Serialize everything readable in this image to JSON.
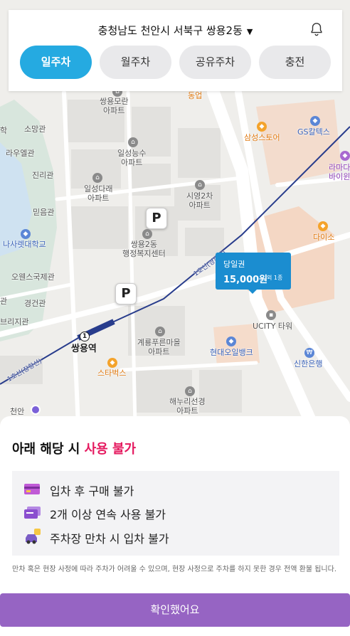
{
  "header": {
    "location": "충청남도 천안시 서북구 쌍용2동",
    "tabs": [
      {
        "label": "일주차",
        "active": true
      },
      {
        "label": "월주차",
        "active": false
      },
      {
        "label": "공유주차",
        "active": false
      },
      {
        "label": "충전",
        "active": false
      }
    ]
  },
  "map": {
    "rail_label": "1호선(경부선)",
    "rail_label_2": "1호선(장항선)",
    "station_badge": "1",
    "station_name": "쌍용역",
    "parking_marker": "P",
    "places": {
      "ssangyong_moran": "쌍용모란\n아파트",
      "ilseong_neungsu": "일성능수\n아파트",
      "ilseong_darae": "일성다래\n아파트",
      "siyeong2": "시영2차\n아파트",
      "admin_center": "쌍용2동\n행정복지센터",
      "samsung_store": "삼성스토어",
      "gs_caltex": "GS칼텍스",
      "lamada": "라마다\n바이윈",
      "daiso": "다이소",
      "ucity": "UCITY 타워",
      "hyundai_bank": "현대오일뱅크",
      "shinhan": "신한은행",
      "gyeryong": "계룡푸른마을\n아파트",
      "haenuri": "해누리선경\n아파트",
      "starbucks": "스타벅스",
      "somang": "소망관",
      "rauel": "라우엘관",
      "jinri": "진리관",
      "mideum": "믿음관",
      "nasaret": "나사렛대학교",
      "owens": "오웬스국제관",
      "gyeongdeok": "경건관",
      "bridge": "브리지관",
      "gwan": "관",
      "hak": "학",
      "dongup": "동업",
      "cheonan": "천안"
    },
    "price_tag": {
      "kind": "당일권",
      "amount": "15,000원",
      "extra": "외 1종"
    }
  },
  "sheet": {
    "title_prefix": "아래 해당 시 ",
    "title_highlight": "사용 불가",
    "items": [
      "입차 후 구매 불가",
      "2개 이상 연속 사용 불가",
      "주차장 만차 시 입차 불가"
    ],
    "note": "만차 혹은 현장 사정에 따라 주차가 어려울 수 있으며, 현장 사정으로 주차를 하지 못한 경우 전액 환불 됩니다.",
    "confirm_label": "확인했어요"
  },
  "colors": {
    "accent": "#25aae1",
    "warning": "#e5195f",
    "confirm": "#9664c3",
    "price_tag": "#1b8dd0"
  }
}
